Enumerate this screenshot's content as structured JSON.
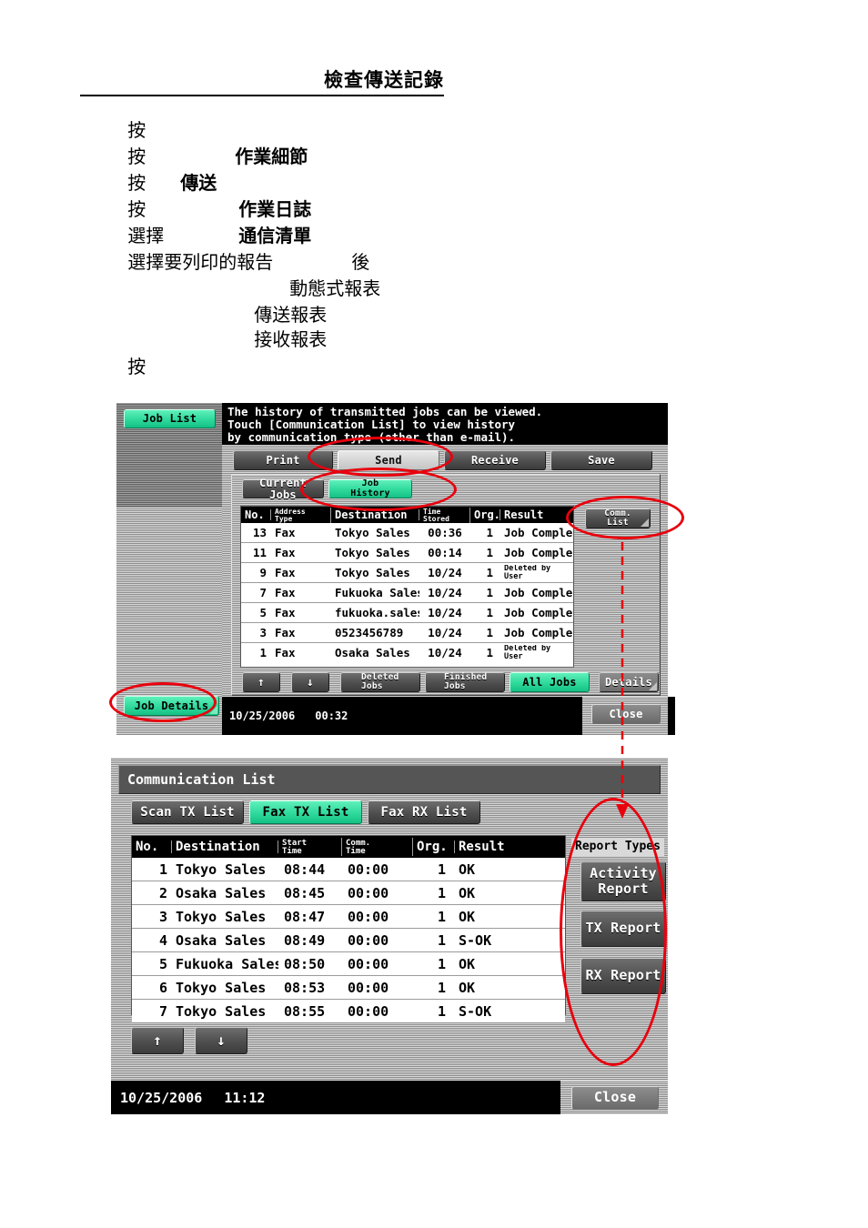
{
  "document": {
    "title": "檢查傳送記錄",
    "lines": [
      {
        "prefix": "按",
        "bold": "作業細節"
      },
      {
        "prefix": "按",
        "bold": "傳送"
      },
      {
        "prefix": "按",
        "bold": "作業日誌"
      },
      {
        "prefix": "按",
        "bold": "通信清單"
      },
      {
        "prefix": "選擇",
        "bold": "後"
      },
      {
        "prefix": "選擇要列印的報告",
        "bold": ""
      },
      {
        "prefix": "",
        "bold": "動態式報表"
      },
      {
        "prefix": "",
        "bold": "傳送報表"
      },
      {
        "prefix": "",
        "bold": "接收報表"
      },
      {
        "prefix": "按",
        "bold": ""
      }
    ]
  },
  "job_list_screen": {
    "sidebar": {
      "job_list_label": "Job List",
      "job_details_label": "Job Details"
    },
    "message": "The history of transmitted jobs can be viewed.\nTouch [Communication List] to view history\nby communication type (other than e-mail).",
    "tabs": [
      {
        "label": "Print",
        "active": false
      },
      {
        "label": "Send",
        "active": true
      },
      {
        "label": "Receive",
        "active": false
      },
      {
        "label": "Save",
        "active": false
      }
    ],
    "subtabs": [
      {
        "label": "Current Jobs",
        "active": false
      },
      {
        "label_line1": "Job",
        "label_line2": "History",
        "active": true
      }
    ],
    "comm_list_button": "Comm.\nList",
    "comm_list_line1": "Comm.",
    "comm_list_line2": "List",
    "table": {
      "columns": [
        "No.",
        "Address Type",
        "Destination",
        "Time Stored",
        "Org.",
        "Result"
      ],
      "col_no": "No.",
      "col_addr_1": "Address",
      "col_addr_2": "Type",
      "col_dest": "Destination",
      "col_time_1": "Time",
      "col_time_2": "Stored",
      "col_org": "Org.",
      "col_result": "Result",
      "rows": [
        {
          "no": "13",
          "type": "Fax",
          "dest": "Tokyo Sales",
          "time": "00:36",
          "org": "1",
          "result": "Job Complete",
          "result2": ""
        },
        {
          "no": "11",
          "type": "Fax",
          "dest": "Tokyo Sales",
          "time": "00:14",
          "org": "1",
          "result": "Job Complete",
          "result2": ""
        },
        {
          "no": "9",
          "type": "Fax",
          "dest": "Tokyo Sales",
          "time": "10/24",
          "org": "1",
          "result": "Deleted by",
          "result2": "User"
        },
        {
          "no": "7",
          "type": "Fax",
          "dest": "Fukuoka Sales",
          "time": "10/24",
          "org": "1",
          "result": "Job Complete",
          "result2": ""
        },
        {
          "no": "5",
          "type": "Fax",
          "dest": "fukuoka.sales@",
          "time": "10/24",
          "org": "1",
          "result": "Job Complete",
          "result2": ""
        },
        {
          "no": "3",
          "type": "Fax",
          "dest": "0523456789",
          "time": "10/24",
          "org": "1",
          "result": "Job Complete",
          "result2": ""
        },
        {
          "no": "1",
          "type": "Fax",
          "dest": "Osaka Sales",
          "time": "10/24",
          "org": "1",
          "result": "Deleted by",
          "result2": "User"
        }
      ]
    },
    "toolbar": {
      "scroll_up": "↑",
      "scroll_down": "↓",
      "deleted_jobs_1": "Deleted",
      "deleted_jobs_2": "Jobs",
      "finished_jobs_1": "Finished",
      "finished_jobs_2": "Jobs",
      "all_jobs": "All Jobs",
      "details": "Details"
    },
    "status": {
      "date": "10/25/2006",
      "time": "00:32",
      "close": "Close"
    }
  },
  "communication_list_screen": {
    "title": "Communication List",
    "tabs": [
      {
        "label": "Scan TX List",
        "active": false
      },
      {
        "label": "Fax TX List",
        "active": true
      },
      {
        "label": "Fax RX List",
        "active": false
      }
    ],
    "table": {
      "col_no": "No.",
      "col_dest": "Destination",
      "col_start_1": "Start",
      "col_start_2": "Time",
      "col_comm_1": "Comm.",
      "col_comm_2": "Time",
      "col_org": "Org.",
      "col_result": "Result",
      "rows": [
        {
          "no": "1",
          "dest": "Tokyo Sales",
          "start": "08:44",
          "comm": "00:00",
          "org": "1",
          "result": "OK"
        },
        {
          "no": "2",
          "dest": "Osaka Sales",
          "start": "08:45",
          "comm": "00:00",
          "org": "1",
          "result": "OK"
        },
        {
          "no": "3",
          "dest": "Tokyo Sales",
          "start": "08:47",
          "comm": "00:00",
          "org": "1",
          "result": "OK"
        },
        {
          "no": "4",
          "dest": "Osaka Sales",
          "start": "08:49",
          "comm": "00:00",
          "org": "1",
          "result": "S-OK"
        },
        {
          "no": "5",
          "dest": "Fukuoka Sales",
          "start": "08:50",
          "comm": "00:00",
          "org": "1",
          "result": "OK"
        },
        {
          "no": "6",
          "dest": "Tokyo Sales",
          "start": "08:53",
          "comm": "00:00",
          "org": "1",
          "result": "OK"
        },
        {
          "no": "7",
          "dest": "Tokyo Sales",
          "start": "08:55",
          "comm": "00:00",
          "org": "1",
          "result": "S-OK"
        }
      ]
    },
    "report_types": {
      "label": "Report Types",
      "buttons": [
        {
          "line1": "Activity",
          "line2": "Report"
        },
        {
          "line1": "TX Report",
          "line2": ""
        },
        {
          "line1": "RX Report",
          "line2": ""
        }
      ]
    },
    "toolbar": {
      "scroll_up": "↑",
      "scroll_down": "↓"
    },
    "status": {
      "date": "10/25/2006",
      "time": "11:12",
      "close": "Close"
    }
  },
  "annotation_color": "#e8000d"
}
